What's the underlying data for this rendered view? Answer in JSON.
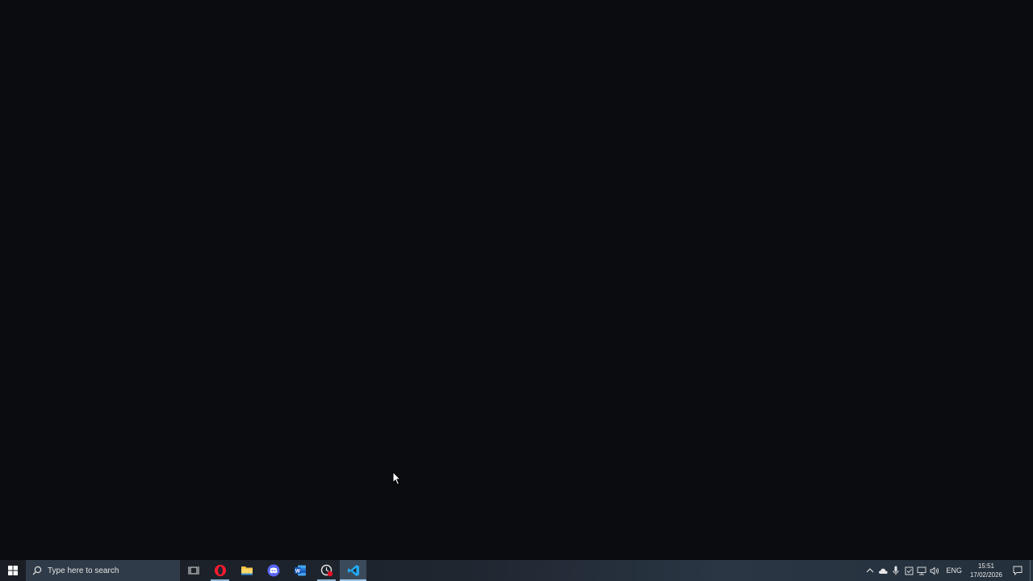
{
  "desktop": {
    "background_color": "#0b0c10"
  },
  "taskbar": {
    "start_icon": "windows-logo-icon",
    "search": {
      "icon": "search-icon",
      "placeholder": "Type here to search"
    },
    "apps": [
      {
        "name": "task-view",
        "icon": "task-view-icon",
        "running": false,
        "active": false
      },
      {
        "name": "opera",
        "icon": "opera-icon",
        "running": true,
        "active": false
      },
      {
        "name": "file-explorer",
        "icon": "folder-icon",
        "running": false,
        "active": false
      },
      {
        "name": "discord",
        "icon": "discord-icon",
        "running": false,
        "active": false
      },
      {
        "name": "word",
        "icon": "word-icon",
        "running": false,
        "active": false
      },
      {
        "name": "recorder",
        "icon": "record-icon",
        "running": true,
        "active": false
      },
      {
        "name": "vscode",
        "icon": "vscode-icon",
        "running": true,
        "active": true
      }
    ],
    "tray": {
      "icons": [
        "chevron-up-icon",
        "cloud-icon",
        "microphone-icon",
        "security-icon",
        "network-icon",
        "volume-icon"
      ],
      "language": "ENG",
      "time": "15:51",
      "date": "17/02/2026",
      "notification_icon": "notification-icon"
    }
  },
  "colors": {
    "accent_blue": "#0078d7",
    "opera_red": "#ff1b2d",
    "explorer_yellow": "#f6c344",
    "discord_blurple": "#5865f2",
    "word_blue": "#2b579a",
    "vscode_blue": "#23a9f2"
  }
}
